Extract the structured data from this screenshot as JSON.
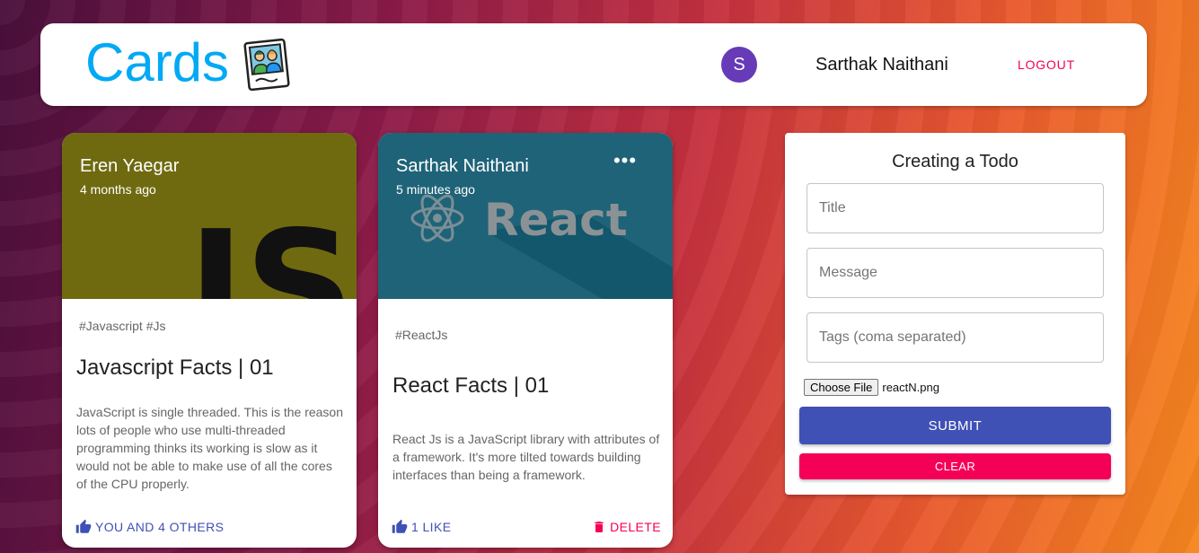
{
  "appbar": {
    "brand": "Cards",
    "avatar_letter": "S",
    "avatar_color": "#673ab7",
    "username": "Sarthak Naithani",
    "logout_label": "LOGOUT"
  },
  "posts": [
    {
      "author": "Eren Yaegar",
      "time": "4 months ago",
      "tags": "#Javascript #Js",
      "title": "Javascript Facts | 01",
      "message": "JavaScript is single threaded. This is the reason lots of people who use multi-threaded programming thinks its working is slow as it would not be able to make use of all the cores of the CPU properly.",
      "like_label": "YOU AND 4 OTHERS",
      "image_logo_text": "JS",
      "media_color": "#6f6a10"
    },
    {
      "author": "Sarthak Naithani",
      "time": "5 minutes ago",
      "more_icon": "•••",
      "tags": "#ReactJs",
      "title": "React Facts | 01",
      "message": "React Js is a JavaScript library with attributes of a framework. It's more tilted towards building interfaces than being a framework.",
      "like_label": "1 LIKE",
      "delete_label": "DELETE",
      "image_logo_text": "React",
      "media_color": "#1f6378"
    }
  ],
  "form": {
    "title": "Creating a Todo",
    "title_placeholder": "Title",
    "message_placeholder": "Message",
    "tags_placeholder": "Tags (coma separated)",
    "file_button": "Choose File",
    "file_name": "reactN.png",
    "submit_label": "SUBMIT",
    "clear_label": "CLEAR"
  },
  "colors": {
    "brand": "#03a9f4",
    "primary": "#3f51b5",
    "secondary": "#f50057"
  }
}
